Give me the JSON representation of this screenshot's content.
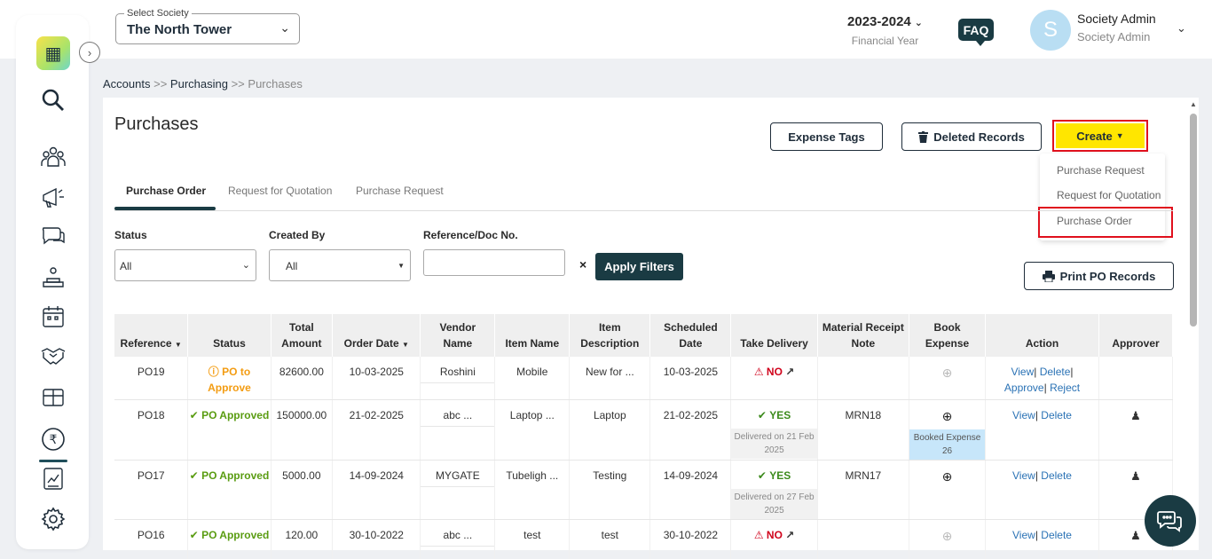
{
  "header": {
    "society_label": "Select Society",
    "society_value": "The North Tower",
    "financial_year": "2023-2024",
    "financial_year_label": "Financial Year",
    "faq_label": "FAQ",
    "avatar_initial": "S",
    "user_name": "Society Admin",
    "user_role": "Society Admin"
  },
  "breadcrumb": {
    "items": [
      "Accounts",
      "Purchasing",
      "Purchases"
    ],
    "separator": ">>"
  },
  "page": {
    "title": "Purchases",
    "expense_tags_label": "Expense Tags",
    "deleted_records_label": "Deleted Records",
    "create_label": "Create",
    "print_label": "Print PO Records"
  },
  "create_menu": {
    "items": [
      "Purchase Request",
      "Request for Quotation",
      "Purchase Order"
    ]
  },
  "tabs": [
    "Purchase Order",
    "Request for Quotation",
    "Purchase Request"
  ],
  "filters": {
    "status_label": "Status",
    "status_value": "All",
    "created_by_label": "Created By",
    "created_by_value": "All",
    "ref_label": "Reference/Doc No.",
    "ref_value": "",
    "clear_label": "×",
    "apply_label": "Apply Filters"
  },
  "table": {
    "headers": [
      "Reference",
      "Status",
      "Total Amount",
      "Order Date",
      "Vendor Name",
      "Item Name",
      "Item Description",
      "Scheduled Date",
      "Take Delivery",
      "Material Receipt Note",
      "Book Expense",
      "Action",
      "Approver"
    ],
    "rows": [
      {
        "ref": "PO19",
        "status": "PO to Approve",
        "amount": "82600.00",
        "order_date": "10-03-2025",
        "vendor": "Roshini",
        "item": "Mobile",
        "desc": "New for ...",
        "sched": "10-03-2025",
        "delivery": "NO",
        "delivered_note": "",
        "mrn": "",
        "expense_note": "",
        "actions": [
          "View",
          "Delete",
          "Approve",
          "Reject"
        ]
      },
      {
        "ref": "PO18",
        "status": "PO Approved",
        "amount": "150000.00",
        "order_date": "21-02-2025",
        "vendor": "abc ...",
        "item": "Laptop ...",
        "desc": "Laptop",
        "sched": "21-02-2025",
        "delivery": "YES",
        "delivered_note": "Delivered on 21 Feb 2025",
        "mrn": "MRN18",
        "expense_note": "Booked Expense 26",
        "actions": [
          "View",
          "Delete"
        ]
      },
      {
        "ref": "PO17",
        "status": "PO Approved",
        "amount": "5000.00",
        "order_date": "14-09-2024",
        "vendor": "MYGATE",
        "item": "Tubeligh ...",
        "desc": "Testing",
        "sched": "14-09-2024",
        "delivery": "YES",
        "delivered_note": "Delivered on 27 Feb 2025",
        "mrn": "MRN17",
        "expense_note": "",
        "actions": [
          "View",
          "Delete"
        ]
      },
      {
        "ref": "PO16",
        "status": "PO Approved",
        "amount": "120.00",
        "order_date": "30-10-2022",
        "vendor": "abc ...",
        "item": "test",
        "desc": "test",
        "sched": "30-10-2022",
        "delivery": "NO",
        "delivered_note": "",
        "mrn": "",
        "expense_note": "",
        "actions": [
          "View",
          "Delete"
        ]
      }
    ]
  },
  "colors": {
    "primary": "#1a3b43",
    "accent": "#ffe600",
    "highlight": "#e0101d",
    "link": "#2a72b5"
  }
}
